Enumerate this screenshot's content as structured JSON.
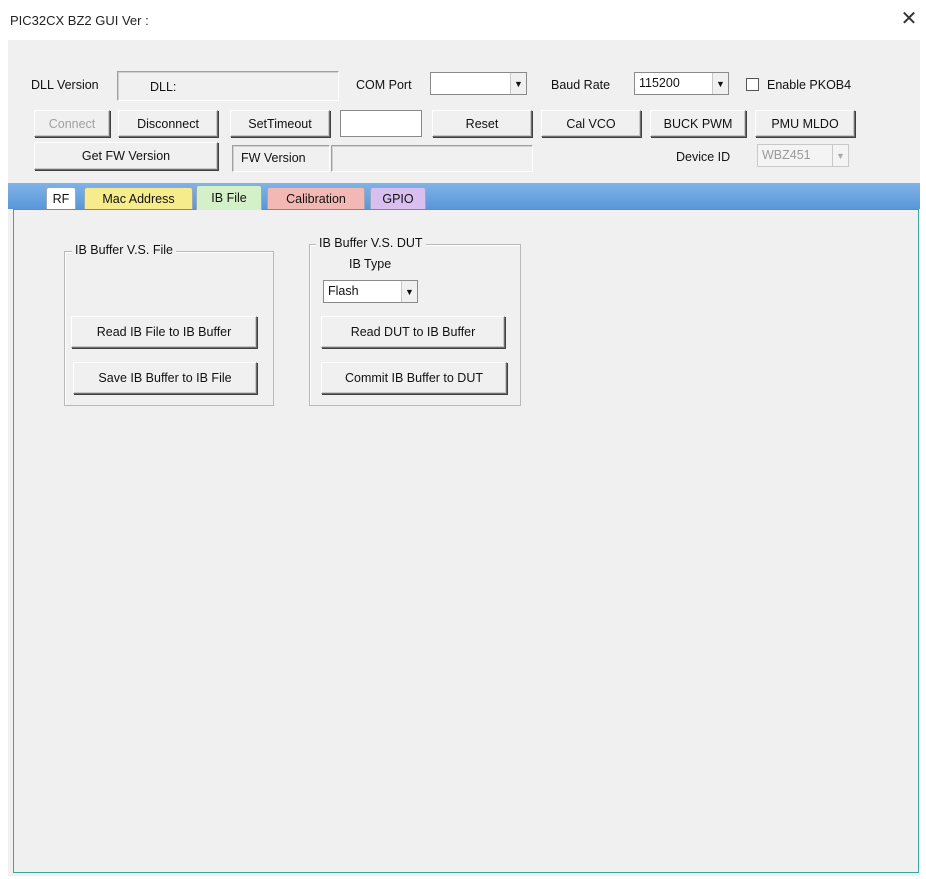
{
  "window": {
    "title": "PIC32CX BZ2 GUI Ver :",
    "close_glyph": "✕"
  },
  "header": {
    "dll_version_label": "DLL Version",
    "dll_value": "DLL:",
    "com_port_label": "COM Port",
    "com_port_value": "",
    "baud_rate_label": "Baud Rate",
    "baud_rate_value": "115200",
    "enable_pkob4_label": "Enable PKOB4",
    "enable_pkob4_checked": false,
    "connect_label": "Connect",
    "disconnect_label": "Disconnect",
    "set_timeout_label": "SetTimeout",
    "timeout_value": "",
    "reset_label": "Reset",
    "cal_vco_label": "Cal VCO",
    "buck_pwm_label": "BUCK PWM",
    "pmu_mldo_label": "PMU MLDO",
    "get_fw_version_label": "Get FW Version",
    "fw_version_label": "FW Version",
    "fw_version_value": "",
    "device_id_label": "Device ID",
    "device_id_value": "WBZ451"
  },
  "tabs": [
    {
      "label": "RF",
      "color": "#ffffff"
    },
    {
      "label": "Mac Address",
      "color": "#f6ec8c"
    },
    {
      "label": "IB File",
      "color": "#d4f0c8",
      "active": true
    },
    {
      "label": "Calibration",
      "color": "#f4b8b4"
    },
    {
      "label": "GPIO",
      "color": "#d8bff0"
    }
  ],
  "ib_file": {
    "file_group": {
      "title": "IB Buffer V.S. File",
      "read_button": "Read IB File to IB Buffer",
      "save_button": "Save IB Buffer to IB File"
    },
    "dut_group": {
      "title": "IB Buffer V.S. DUT",
      "ib_type_label": "IB Type",
      "ib_type_value": "Flash",
      "read_button": "Read DUT to IB Buffer",
      "commit_button": "Commit IB Buffer to DUT"
    }
  },
  "icons": {
    "close": "close-icon",
    "dropdown": "chevron-down-icon"
  },
  "colors": {
    "tabstrip": "#6aa6e0",
    "panel_border": "#3aa6a0",
    "window_bg": "#f0f0f0"
  }
}
